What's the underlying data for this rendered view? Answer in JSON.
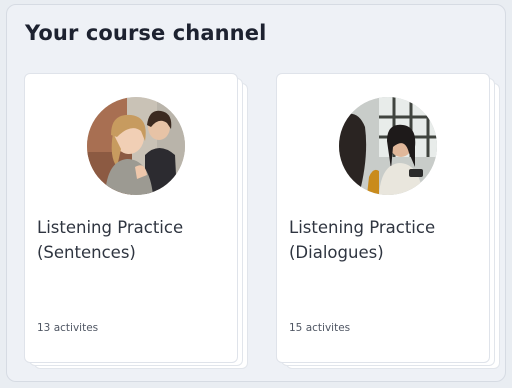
{
  "section": {
    "title": "Your course channel"
  },
  "courses": [
    {
      "title_line1": "Listening Practice",
      "title_line2": "(Sentences)",
      "count": "13 activites"
    },
    {
      "title_line1": "Listening Practice",
      "title_line2": "(Dialogues)",
      "count": "15 activites"
    }
  ]
}
